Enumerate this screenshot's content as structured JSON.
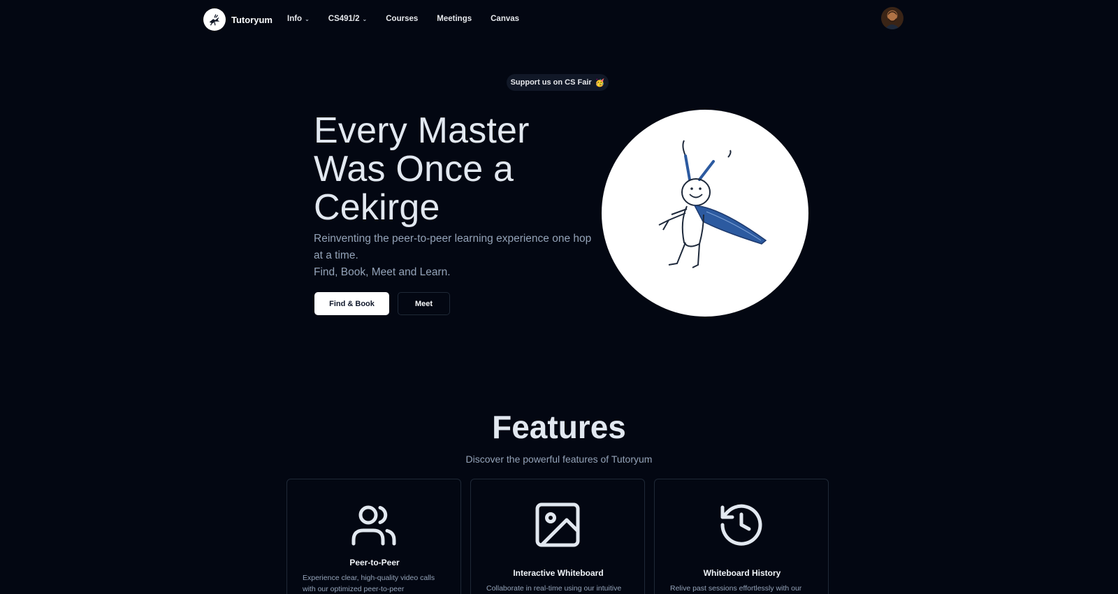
{
  "nav": {
    "brand": "Tutoryum",
    "links": [
      {
        "label": "Info",
        "dropdown": true
      },
      {
        "label": "CS491/2",
        "dropdown": true
      },
      {
        "label": "Courses",
        "dropdown": false
      },
      {
        "label": "Meetings",
        "dropdown": false
      },
      {
        "label": "Canvas",
        "dropdown": false
      }
    ],
    "avatar_icon": "user-avatar"
  },
  "pill": {
    "label": "Support us on CS Fair",
    "emoji": "🥳"
  },
  "hero": {
    "title_lines": [
      "Every Master",
      "Was Once a",
      "Cekirge"
    ],
    "subtitle_lines": [
      "Reinventing the peer-to-peer learning experience one hop",
      "at a time.",
      "Find, Book, Meet and Learn."
    ],
    "primary_button": "Find & Book",
    "secondary_button": "Meet",
    "illustration": "grasshopper-illustration"
  },
  "features": {
    "title": "Features",
    "subtitle": "Discover the powerful features of Tutoryum",
    "cards": [
      {
        "icon": "users-icon",
        "title": "Peer-to-Peer",
        "desc_lines": [
          "Experience clear, high-quality video calls",
          "with our optimized peer-to-peer"
        ]
      },
      {
        "icon": "image-icon",
        "title": "Interactive Whiteboard",
        "desc_lines": [
          "Collaborate in real-time using our intuitive"
        ]
      },
      {
        "icon": "history-icon",
        "title": "Whiteboard History",
        "desc_lines": [
          "Relive past sessions effortlessly with our"
        ]
      }
    ]
  },
  "colors": {
    "background": "#030712",
    "text": "#e2e8f0",
    "muted": "#94a3b8",
    "accent_blue": "#2c5aa0"
  }
}
